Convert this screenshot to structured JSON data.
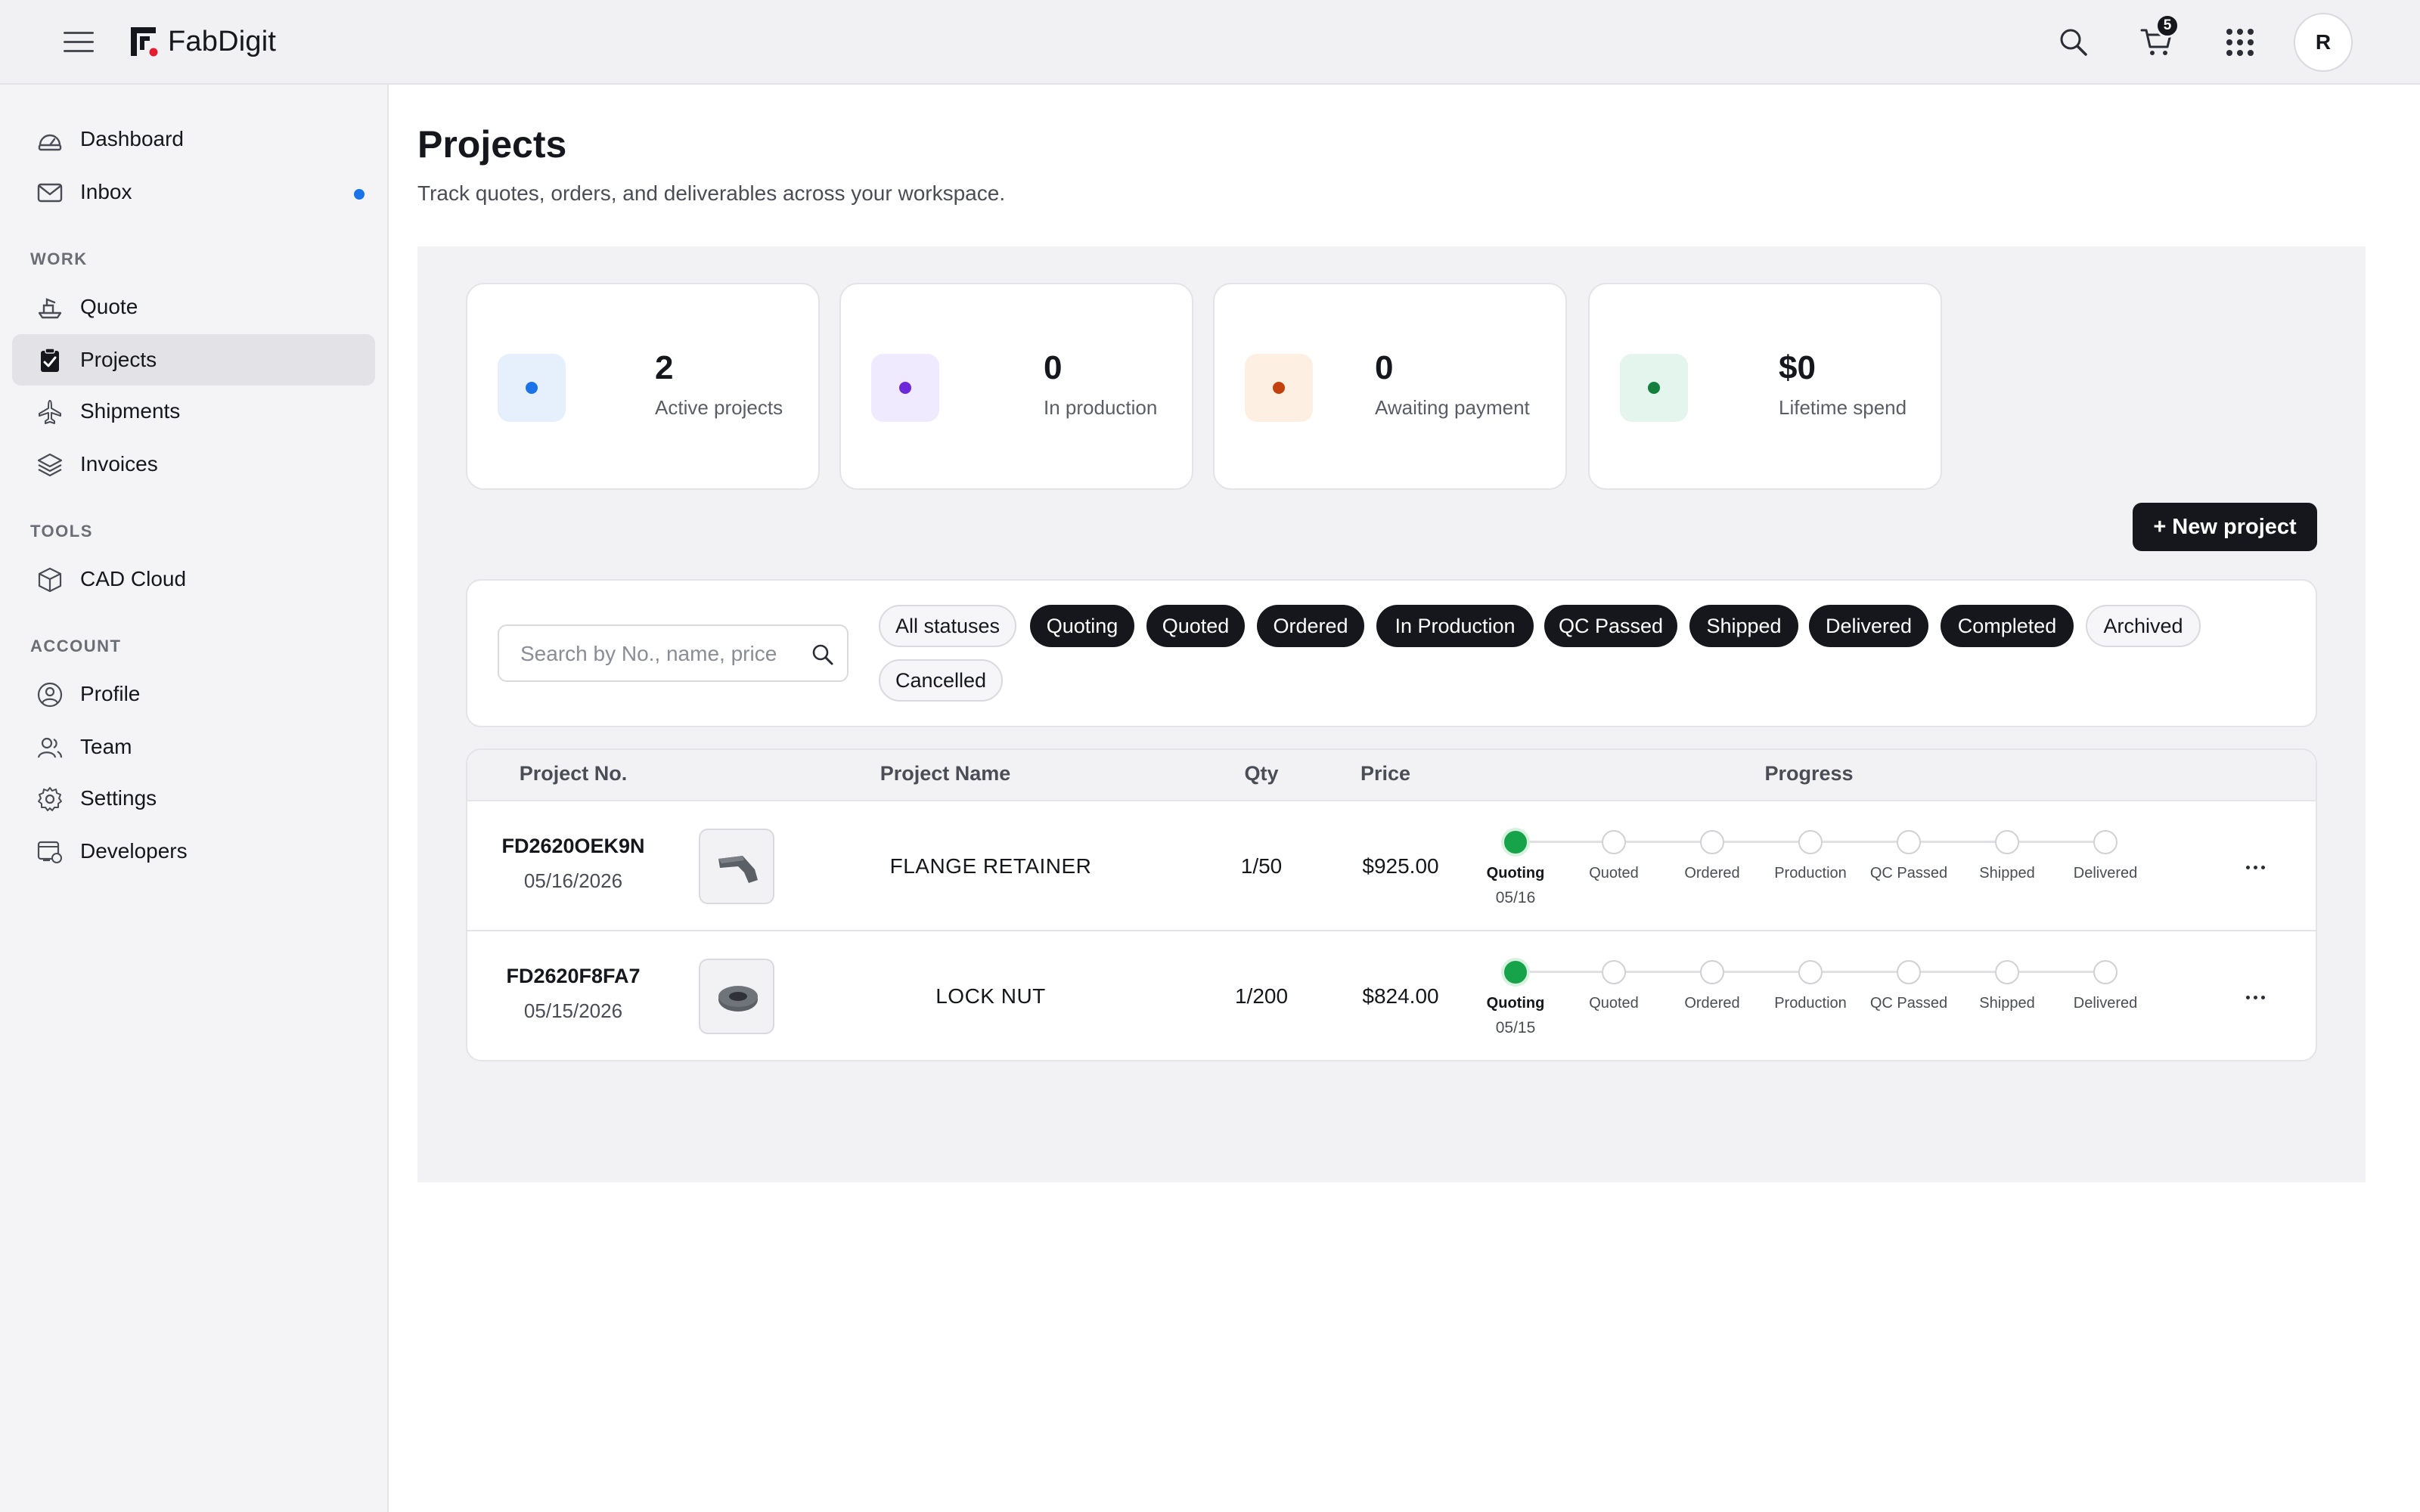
{
  "app": {
    "name": "FabDigit"
  },
  "topbar": {
    "cart_count": "5",
    "avatar_initial": "R"
  },
  "sidebar": {
    "top_items": [
      {
        "label": "Dashboard",
        "icon": "dashboard-icon"
      },
      {
        "label": "Inbox",
        "icon": "mail-icon",
        "unread": true
      }
    ],
    "work_title": "WORK",
    "work_items": [
      {
        "label": "Quote",
        "icon": "quote-icon"
      },
      {
        "label": "Projects",
        "icon": "clipboard-check-icon",
        "active": true
      },
      {
        "label": "Shipments",
        "icon": "plane-icon"
      },
      {
        "label": "Invoices",
        "icon": "layers-icon"
      }
    ],
    "tools_title": "TOOLS",
    "tools_items": [
      {
        "label": "CAD Cloud",
        "icon": "cube-icon"
      }
    ],
    "account_title": "ACCOUNT",
    "account_items": [
      {
        "label": "Profile",
        "icon": "user-circle-icon"
      },
      {
        "label": "Team",
        "icon": "team-icon"
      },
      {
        "label": "Settings",
        "icon": "gear-icon"
      },
      {
        "label": "Developers",
        "icon": "code-window-icon"
      }
    ]
  },
  "page": {
    "title": "Projects",
    "subtitle": "Track quotes, orders, and deliverables across your workspace."
  },
  "stats": [
    {
      "value": "2",
      "label": "Active projects",
      "bg": "#e6f0fd",
      "dot": "#1a73e8"
    },
    {
      "value": "0",
      "label": "In production",
      "bg": "#efeafd",
      "dot": "#6d28d9"
    },
    {
      "value": "0",
      "label": "Awaiting payment",
      "bg": "#fdf0e3",
      "dot": "#c2410c"
    },
    {
      "value": "$0",
      "label": "Lifetime spend",
      "bg": "#e3f5ec",
      "dot": "#15803d"
    }
  ],
  "new_project_label": "+ New project",
  "search": {
    "placeholder": "Search by No., name, price",
    "value": ""
  },
  "filters": [
    {
      "label": "All statuses",
      "selected": false
    },
    {
      "label": "Quoting",
      "selected": true
    },
    {
      "label": "Quoted",
      "selected": true
    },
    {
      "label": "Ordered",
      "selected": true
    },
    {
      "label": "In Production",
      "selected": true
    },
    {
      "label": "QC Passed",
      "selected": true
    },
    {
      "label": "Shipped",
      "selected": true
    },
    {
      "label": "Delivered",
      "selected": true
    },
    {
      "label": "Completed",
      "selected": true
    },
    {
      "label": "Archived",
      "selected": false
    },
    {
      "label": "Cancelled",
      "selected": false
    }
  ],
  "table": {
    "headers": {
      "project_no": "Project No.",
      "project_name": "Project Name",
      "qty": "Qty",
      "price": "Price",
      "progress": "Progress"
    },
    "steps": [
      "Quoting",
      "Quoted",
      "Ordered",
      "Production",
      "QC Passed",
      "Shipped",
      "Delivered"
    ],
    "rows": [
      {
        "project_no": "FD2620OEK9N",
        "date": "05/16/2026",
        "name": "FLANGE RETAINER",
        "qty": "1/50",
        "price": "$925.00",
        "current_step": 0,
        "step_date": "05/16"
      },
      {
        "project_no": "FD2620F8FA7",
        "date": "05/15/2026",
        "name": "LOCK NUT",
        "qty": "1/200",
        "price": "$824.00",
        "current_step": 0,
        "step_date": "05/15"
      }
    ]
  }
}
